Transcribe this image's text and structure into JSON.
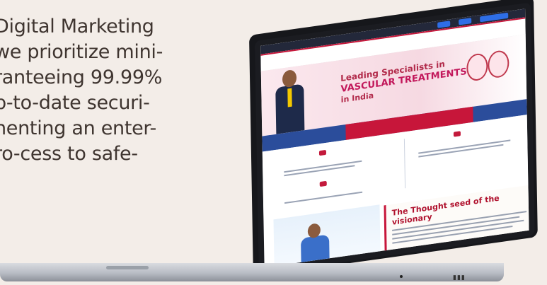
{
  "copy_lines": [
    "Digital Marketing",
    "we prioritize mini-",
    "ranteeing 99.99%",
    "p-to-date securi-",
    "nenting an enter-",
    "ro-cess to safe-"
  ],
  "screen": {
    "logo": "",
    "hero_line1": "Leading Specialists in",
    "hero_line2": "VASCULAR TREATMENTS",
    "hero_line3": "in India",
    "phone": "",
    "card_titles": [
      "",
      "",
      ""
    ],
    "thought_title": "The Thought seed of the visionary"
  },
  "colors": {
    "page_bg": "#f3ede8",
    "text": "#3f3530",
    "brand_red": "#c7163a",
    "brand_blue": "#2b4d9b"
  }
}
